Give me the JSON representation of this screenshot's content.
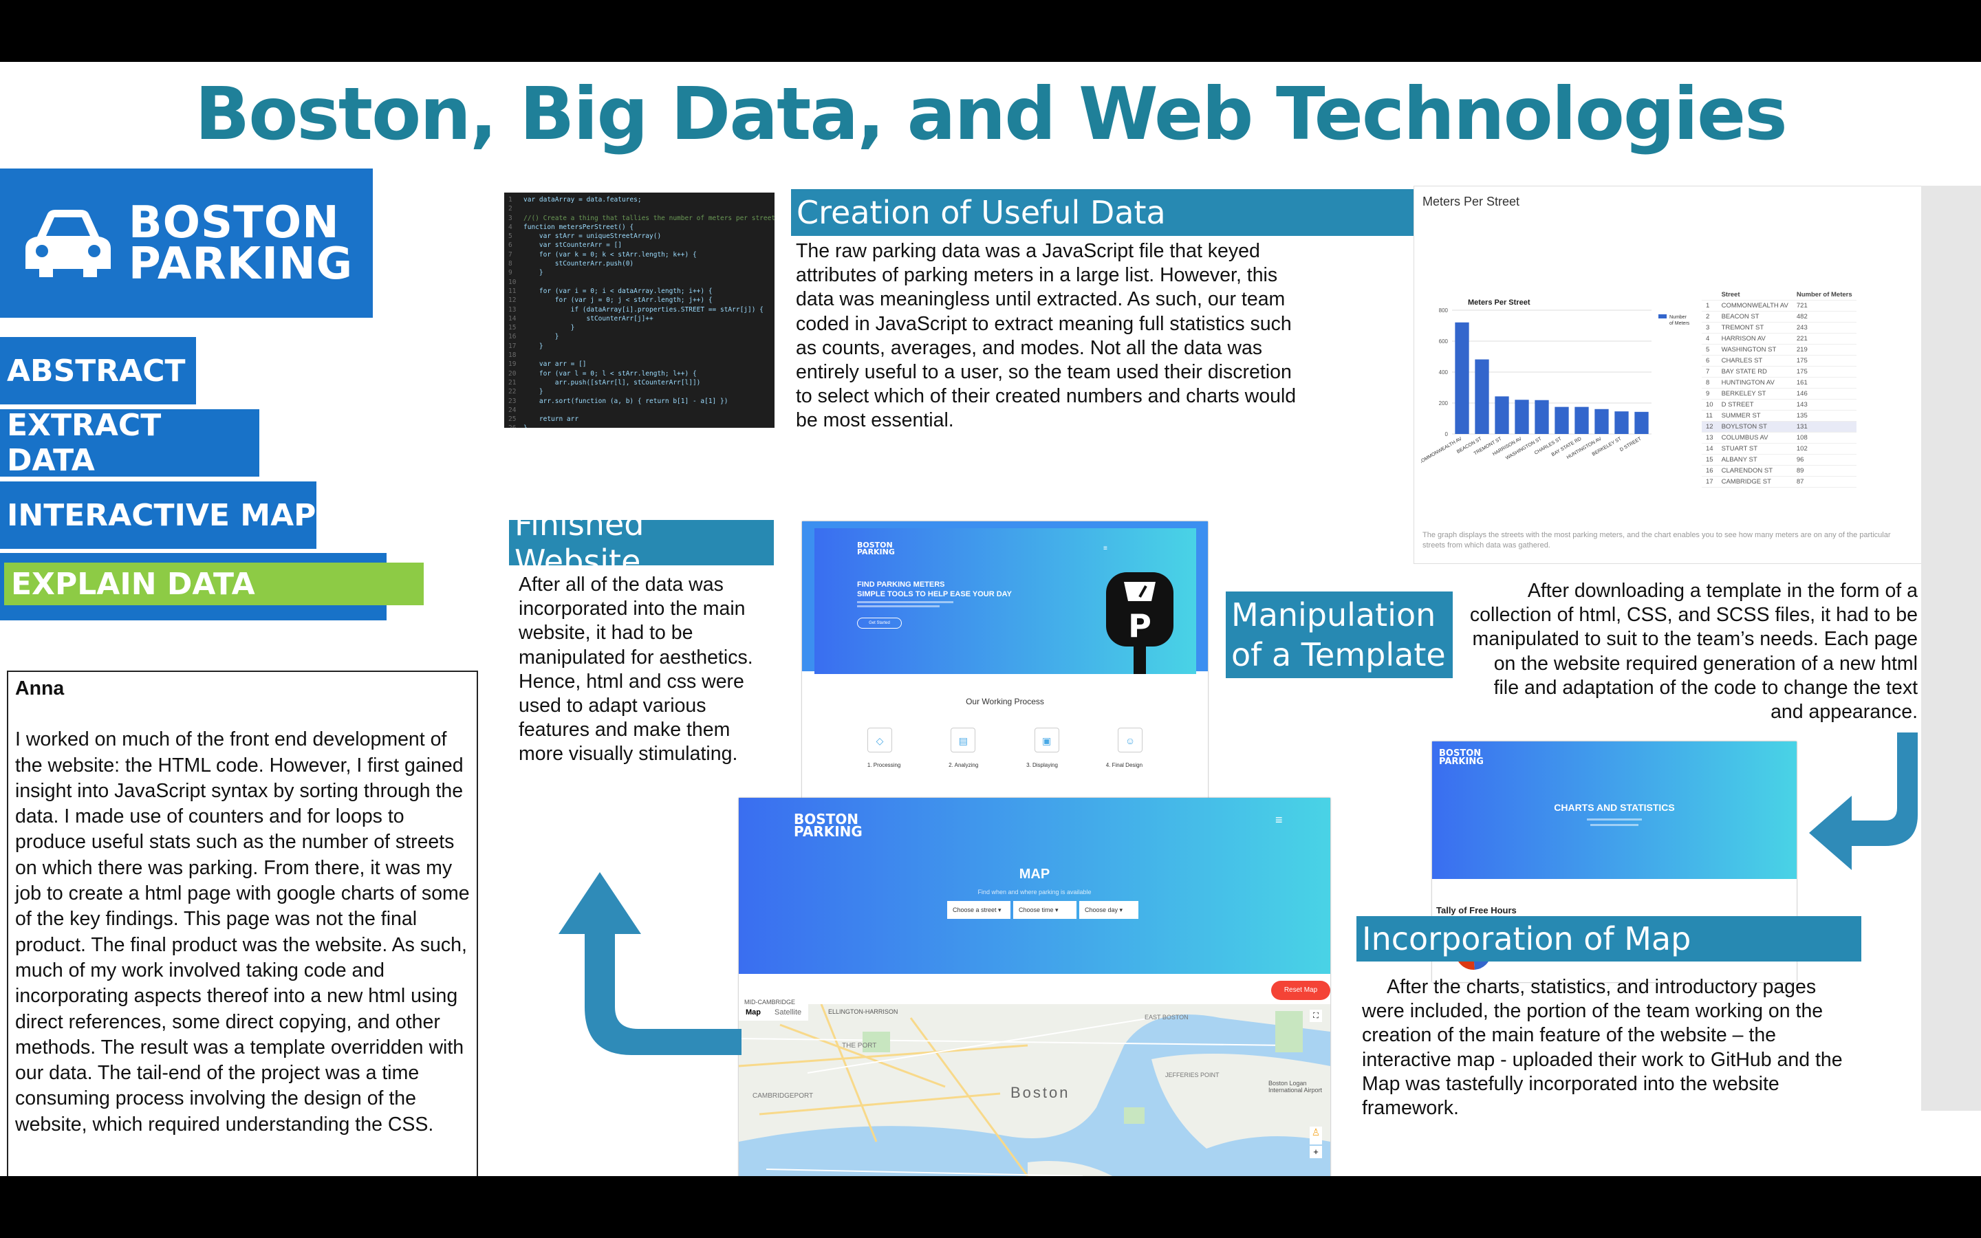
{
  "title": "Boston, Big Data, and Web Technologies",
  "logo": {
    "line1": "BOSTON",
    "line2": "PARKING"
  },
  "nav": [
    "ABSTRACT",
    "EXTRACT DATA",
    "INTERACTIVE MAP",
    "EXPLAIN DATA"
  ],
  "bio": {
    "name": "Anna",
    "text": "I worked on much of the front end development of the website: the HTML code. However, I first gained insight into JavaScript syntax by sorting through the data. I made use of counters and for loops to produce useful stats such as the number of streets on which there was parking. From there, it was my job to create a html page with google charts of some of the key findings. This page was not the final product. The final product was the website.  As such, much of my work involved taking code and incorporating aspects thereof into a new html using direct references, some direct copying, and other methods. The result was a template overridden with our data. The tail-end of the project was a time consuming process involving the design of the website, which required understanding the CSS."
  },
  "sections": {
    "creation": {
      "heading": "Creation of Useful Data",
      "body": "The raw parking data was a JavaScript file that keyed attributes of parking meters in a large list. However, this data was meaningless until extracted. As such, our team coded in JavaScript to extract meaning full statistics such as counts, averages, and modes. Not all the data was entirely useful to a user, so the team used their discretion to select which of their created numbers and charts would be most essential."
    },
    "finished": {
      "heading": "Finished Website",
      "body": "After all of the data was incorporated into the main website, it had to be manipulated for aesthetics. Hence, html and css were used to adapt various features and make them more visually stimulating."
    },
    "manipulation": {
      "heading_line1": "Manipulation",
      "heading_line2": "of a Template",
      "body": "After downloading a template in the form of a collection of html, CSS, and SCSS files, it had to be manipulated to suit to the team’s needs. Each page on the website required generation of a new html file and adaptation of the code to change the text and appearance."
    },
    "incorporation": {
      "heading": "Incorporation of Map",
      "body": "After the charts, statistics, and introductory pages were included, the portion of the team working on the creation of the main feature of the website – the interactive map - uploaded their work to GitHub and the Map was tastefully incorporated into the website framework."
    }
  },
  "code_lines": [
    "var dataArray = data.features;",
    "",
    "//() Create a thing that tallies the number of meters per street",
    "function metersPerStreet() {",
    "    var stArr = uniqueStreetArray()",
    "    var stCounterArr = []",
    "    for (var k = 0; k < stArr.length; k++) {",
    "        stCounterArr.push(0)",
    "    }",
    "",
    "    for (var i = 0; i < dataArray.length; i++) {",
    "        for (var j = 0; j < stArr.length; j++) {",
    "            if (dataArray[i].properties.STREET == stArr[j]) {",
    "                stCounterArr[j]++",
    "            }",
    "        }",
    "    }",
    "",
    "    var arr = []",
    "    for (var l = 0; l < stArr.length; l++) {",
    "        arr.push([stArr[l], stCounterArr[l]])",
    "    }",
    "    arr.sort(function (a, b) { return b[1] - a[1] })",
    "",
    "    return arr",
    "}"
  ],
  "chart_panel": {
    "header": "Meters Per Street",
    "caption": "The graph displays the streets with the most parking meters, and the chart enables you to see how many meters are on any of the particular streets from which data was gathered.",
    "table_headers": [
      "Street",
      "Number of Meters"
    ],
    "rows": [
      [
        "1",
        "COMMONWEALTH AV",
        "721"
      ],
      [
        "2",
        "BEACON ST",
        "482"
      ],
      [
        "3",
        "TREMONT ST",
        "243"
      ],
      [
        "4",
        "HARRISON AV",
        "221"
      ],
      [
        "5",
        "WASHINGTON ST",
        "219"
      ],
      [
        "6",
        "CHARLES ST",
        "175"
      ],
      [
        "7",
        "BAY STATE RD",
        "175"
      ],
      [
        "8",
        "HUNTINGTON AV",
        "161"
      ],
      [
        "9",
        "BERKELEY ST",
        "146"
      ],
      [
        "10",
        "D STREET",
        "143"
      ],
      [
        "11",
        "SUMMER ST",
        "135"
      ],
      [
        "12",
        "BOYLSTON ST",
        "131"
      ],
      [
        "13",
        "COLUMBUS AV",
        "108"
      ],
      [
        "14",
        "STUART ST",
        "102"
      ],
      [
        "15",
        "ALBANY ST",
        "96"
      ],
      [
        "16",
        "CLARENDON ST",
        "89"
      ],
      [
        "17",
        "CAMBRIDGE ST",
        "87"
      ]
    ]
  },
  "chart_data": {
    "type": "bar",
    "title": "Meters Per Street",
    "categories": [
      "COMMONWEALTH AV",
      "BEACON ST",
      "TREMONT ST",
      "HARRISON AV",
      "WASHINGTON ST",
      "CHARLES ST",
      "BAY STATE RD",
      "HUNTINGTON AV",
      "BERKELEY ST",
      "D STREET"
    ],
    "series": [
      {
        "name": "Number of Meters",
        "values": [
          721,
          482,
          243,
          221,
          219,
          175,
          175,
          161,
          146,
          143
        ]
      }
    ],
    "yticks": [
      "0",
      "200",
      "400",
      "600",
      "800"
    ],
    "ylim": [
      0,
      800
    ],
    "color": "#3366cc",
    "legend": "right"
  },
  "site1": {
    "hero_line1": "FIND PARKING METERS",
    "hero_line2": "SIMPLE TOOLS TO HELP EASE YOUR DAY",
    "button": "Get Started",
    "process_title": "Our Working Process",
    "steps": [
      "1. Processing",
      "2. Analyzing",
      "3. Displaying",
      "4. Final Design"
    ]
  },
  "site2": {
    "title": "CHARTS AND STATISTICS",
    "tally_title": "Tally of Free Hours"
  },
  "map_site": {
    "title": "MAP",
    "subtitle": "Find when and where parking is available",
    "dropdowns": [
      "Choose a street",
      "Choose time",
      "Choose day"
    ],
    "reset": "Reset Map",
    "tabs": [
      "Map",
      "Satellite"
    ],
    "labels": [
      "MID-CAMBRIDGE",
      "ELLINGTON-HARRISON",
      "THE PORT",
      "CAMBRIDGEPORT",
      "EAST BOSTON",
      "JEFFERIES POINT",
      "Boston",
      "Boston Logan International Airport"
    ]
  },
  "colors": {
    "accent": "#1f8099",
    "nav": "#1872c8",
    "active": "#8dcb45",
    "section": "#2789b2",
    "arrow": "#2f8bb8"
  }
}
